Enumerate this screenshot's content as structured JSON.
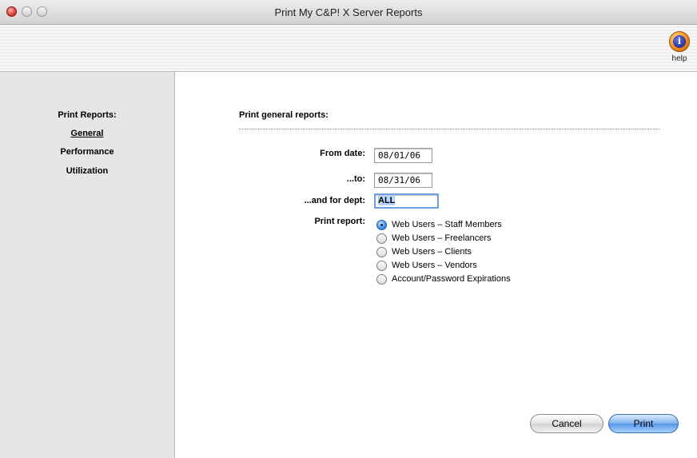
{
  "window": {
    "title": "Print My C&P! X Server Reports"
  },
  "toolbar": {
    "help_label": "help",
    "help_icon": "i"
  },
  "sidebar": {
    "heading": "Print Reports:",
    "items": [
      {
        "label": "General",
        "active": true
      },
      {
        "label": "Performance",
        "active": false
      },
      {
        "label": "Utilization",
        "active": false
      }
    ]
  },
  "main": {
    "section_title": "Print general reports:",
    "from_date": {
      "label": "From date:",
      "value": "08/01/06"
    },
    "to_date": {
      "label": "...to:",
      "value": "08/31/06"
    },
    "dept": {
      "label": "...and for dept:",
      "value": "ALL"
    },
    "print_report": {
      "label": "Print report:",
      "options": [
        {
          "label": "Web Users – Staff Members",
          "checked": true
        },
        {
          "label": "Web Users – Freelancers",
          "checked": false
        },
        {
          "label": "Web Users – Clients",
          "checked": false
        },
        {
          "label": "Web Users – Vendors",
          "checked": false
        },
        {
          "label": "Account/Password Expirations",
          "checked": false
        }
      ]
    },
    "buttons": {
      "cancel": "Cancel",
      "print": "Print"
    }
  },
  "colors": {
    "accent": "#5597e8",
    "close_light": "#e0443e",
    "help_orange": "#f08a14"
  }
}
